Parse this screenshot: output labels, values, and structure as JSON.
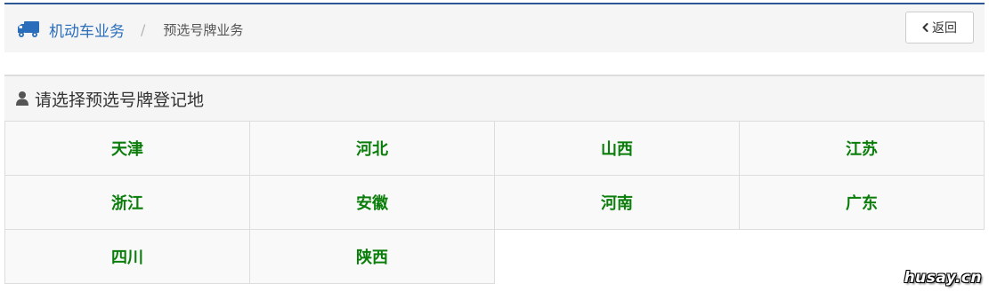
{
  "breadcrumb": {
    "home_label": "机动车业务",
    "separator": "/",
    "current_label": "预选号牌业务",
    "home_icon": "truck-icon"
  },
  "toolbar": {
    "back_label": "返回",
    "back_icon": "chevron-left-icon"
  },
  "panel": {
    "title": "请选择预选号牌登记地",
    "title_icon": "user-icon",
    "regions": [
      {
        "label": "天津"
      },
      {
        "label": "河北"
      },
      {
        "label": "山西"
      },
      {
        "label": "江苏"
      },
      {
        "label": "浙江"
      },
      {
        "label": "安徽"
      },
      {
        "label": "河南"
      },
      {
        "label": "广东"
      },
      {
        "label": "四川"
      },
      {
        "label": "陕西"
      }
    ]
  },
  "watermark": "husay.cn",
  "colors": {
    "accent_blue": "#2a6ebb",
    "top_border": "#2b5797",
    "region_text": "#0a7d0a",
    "header_bg": "#f5f5f5"
  }
}
